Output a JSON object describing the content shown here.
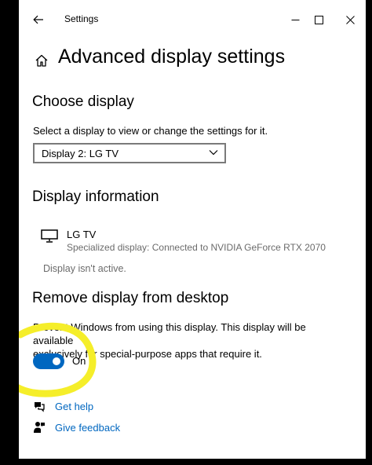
{
  "titlebar": {
    "title": "Settings"
  },
  "page": {
    "title": "Advanced display settings"
  },
  "choose_display": {
    "heading": "Choose display",
    "description": "Select a display to view or change the settings for it.",
    "selected": "Display 2: LG TV"
  },
  "display_info": {
    "heading": "Display information",
    "name": "LG TV",
    "description": "Specialized display: Connected to NVIDIA GeForce RTX 2070",
    "status": "Display isn't active."
  },
  "remove_display": {
    "heading": "Remove display from desktop",
    "line1": "Prevent Windows from using this display. This display will be available",
    "line2": "exclusively for special-purpose apps that require it.",
    "toggle_label": "On",
    "toggle_on": true
  },
  "links": {
    "get_help": "Get help",
    "give_feedback": "Give feedback"
  },
  "colors": {
    "accent": "#0067c0",
    "highlight": "#f5ee2a",
    "secondary_text": "#6b6b6b"
  }
}
